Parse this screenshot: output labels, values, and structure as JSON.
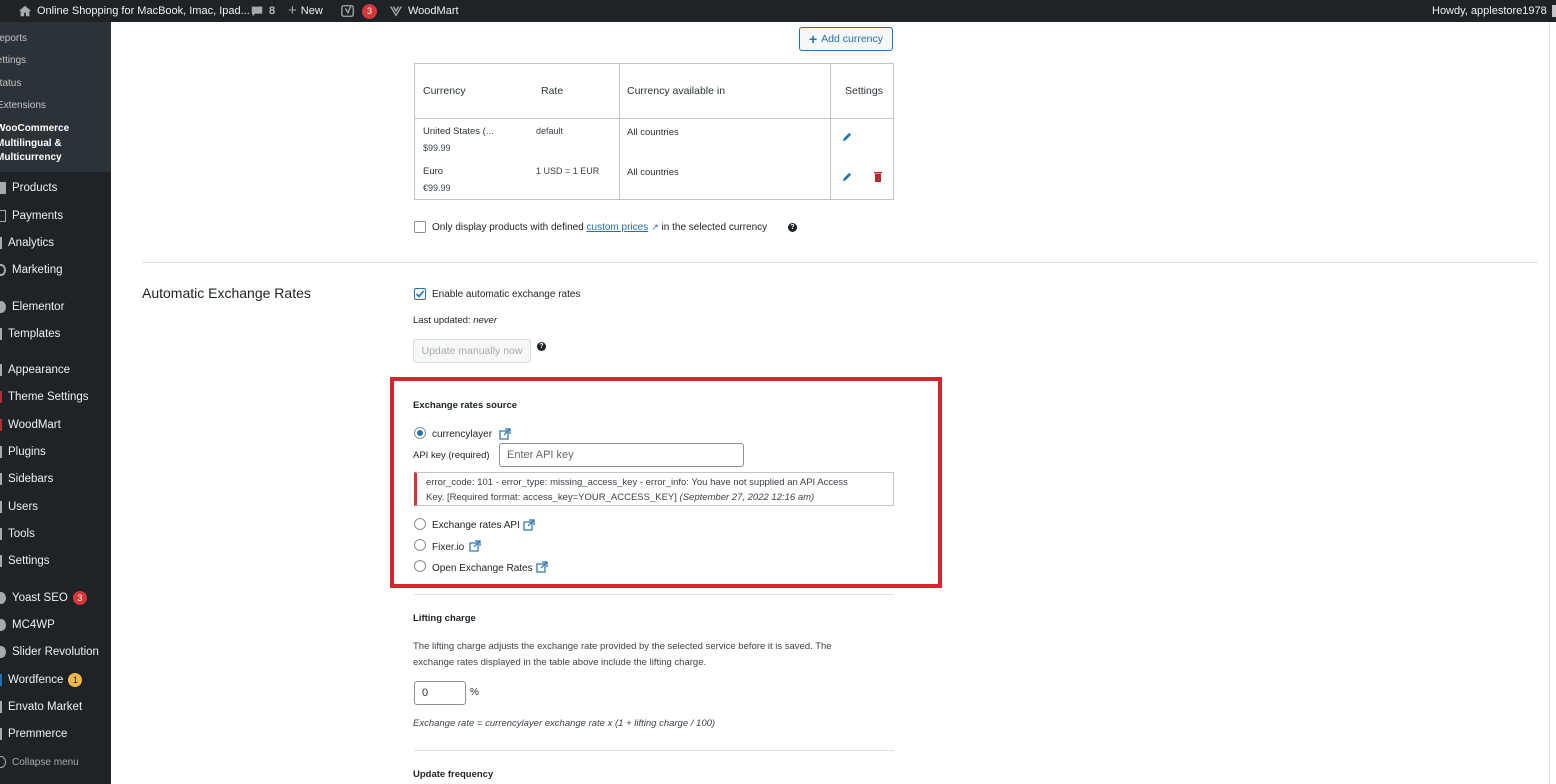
{
  "adminbar": {
    "site_title": "Online Shopping for MacBook, Imac, Ipad...",
    "comments_count": "8",
    "new_label": "New",
    "yoast_count": "3",
    "theme_label": "WoodMart",
    "howdy": "Howdy, applestore1978"
  },
  "sidebar": {
    "submenu": [
      "Reports",
      "Settings",
      "Status",
      "Extensions"
    ],
    "submenu_current": "WooCommerce Multilingual & Multicurrency",
    "items": [
      {
        "label": "Products"
      },
      {
        "label": "Payments"
      },
      {
        "label": "Analytics"
      },
      {
        "label": "Marketing"
      },
      {
        "label": "Elementor"
      },
      {
        "label": "Templates"
      },
      {
        "label": "Appearance"
      },
      {
        "label": "Theme Settings"
      },
      {
        "label": "WoodMart"
      },
      {
        "label": "Plugins"
      },
      {
        "label": "Sidebars"
      },
      {
        "label": "Users"
      },
      {
        "label": "Tools"
      },
      {
        "label": "Settings"
      },
      {
        "label": "Yoast SEO",
        "badge": "3"
      },
      {
        "label": "MC4WP"
      },
      {
        "label": "Slider Revolution"
      },
      {
        "label": "Wordfence",
        "badge": "1"
      },
      {
        "label": "Envato Market"
      },
      {
        "label": "Premmerce"
      }
    ],
    "collapse_label": "Collapse menu"
  },
  "currencies": {
    "add_button": "Add currency",
    "headers": {
      "currency": "Currency",
      "rate": "Rate",
      "available": "Currency available in",
      "settings": "Settings"
    },
    "rows": [
      {
        "name": "United States (...",
        "price": "$99.99",
        "rate": "default",
        "available": "All countries"
      },
      {
        "name": "Euro",
        "price": "€99.99",
        "rate": "1 USD = 1 EUR",
        "available": "All countries"
      }
    ],
    "only_display_before": "Only display products with defined",
    "only_display_link": "custom prices",
    "only_display_after": "in the selected currency"
  },
  "auto_rates": {
    "section_title": "Automatic Exchange Rates",
    "enable_label": "Enable automatic exchange rates",
    "enable_checked": true,
    "last_updated_label": "Last updated:",
    "last_updated_value": "never",
    "update_button": "Update manually now",
    "source_title": "Exchange rates source",
    "sources": [
      {
        "label": "currencylayer",
        "checked": true
      },
      {
        "label": "Exchange rates API",
        "checked": false
      },
      {
        "label": "Fixer.io",
        "checked": false
      },
      {
        "label": "Open Exchange Rates",
        "checked": false
      }
    ],
    "api_key_label": "API key (required)",
    "api_key_placeholder": "Enter API key",
    "error_line1": "error_code: 101 - error_type: missing_access_key - error_info: You have not supplied an API Access",
    "error_line2": "Key. [Required format: access_key=YOUR_ACCESS_KEY]",
    "error_date": "(September 27, 2022 12:16 am)",
    "highlight_color": "#d9232d"
  },
  "lifting": {
    "title": "Lifting charge",
    "desc_line1": "The lifting charge adjusts the exchange rate provided by the selected service before it is saved. The",
    "desc_line2": "exchange rates displayed in the table above include the lifting charge.",
    "value": "0",
    "unit": "%",
    "formula": "Exchange rate = currencylayer exchange rate x (1 + lifting charge / 100)"
  },
  "update_frequency": {
    "title": "Update frequency"
  }
}
